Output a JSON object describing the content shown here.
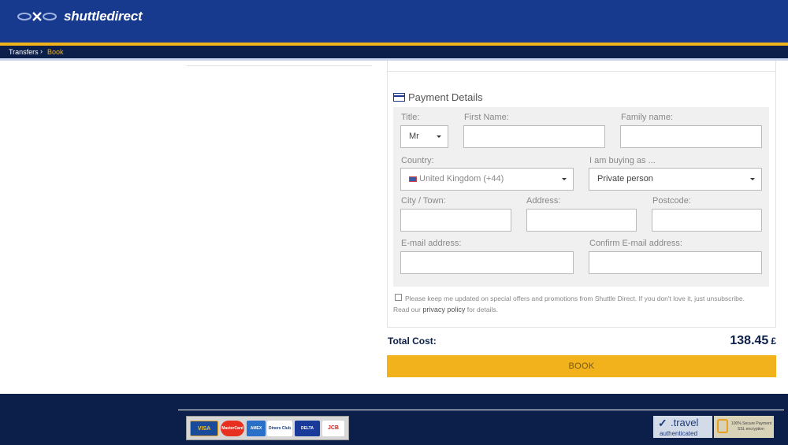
{
  "brand": {
    "name": "shuttledirect"
  },
  "breadcrumb": {
    "items": [
      "Transfers",
      "Book"
    ],
    "separator": "›"
  },
  "payment": {
    "title": "Payment Details",
    "fields": {
      "title": {
        "label": "Title:",
        "value": "Mr"
      },
      "first_name": {
        "label": "First Name:",
        "value": ""
      },
      "family_name": {
        "label": "Family name:",
        "value": ""
      },
      "country": {
        "label": "Country:",
        "value": "United Kingdom (+44)"
      },
      "buying_as": {
        "label": "I am buying as ...",
        "value": "Private person"
      },
      "city": {
        "label": "City / Town:",
        "value": ""
      },
      "address": {
        "label": "Address:",
        "value": ""
      },
      "postcode": {
        "label": "Postcode:",
        "value": ""
      },
      "email": {
        "label": "E-mail address:",
        "value": ""
      },
      "confirm_email": {
        "label": "Confirm E-mail address:",
        "value": ""
      }
    },
    "consent": {
      "text_before": "Please keep me updated on special offers and promotions from Shuttle Direct. If you don't love it, just unsubscribe. Read our ",
      "link": "privacy policy",
      "text_after": " for details."
    }
  },
  "total": {
    "label": "Total Cost:",
    "value": "138.45",
    "currency": "£"
  },
  "book_button": "BOOK",
  "footer": {
    "payment_logos": [
      "VISA",
      "MasterCard",
      "AMEX",
      "Diners Club",
      "DELTA",
      "JCB"
    ],
    "trust_badge_1": {
      "brand": ".travel",
      "caption": "authenticated"
    },
    "trust_badge_2": {
      "line1": "100% Secure Payment",
      "line2": "SSL encryption"
    }
  },
  "colors": {
    "header": "#173a8f",
    "accent": "#f0b21a",
    "dark_navy": "#0c1f4a"
  }
}
